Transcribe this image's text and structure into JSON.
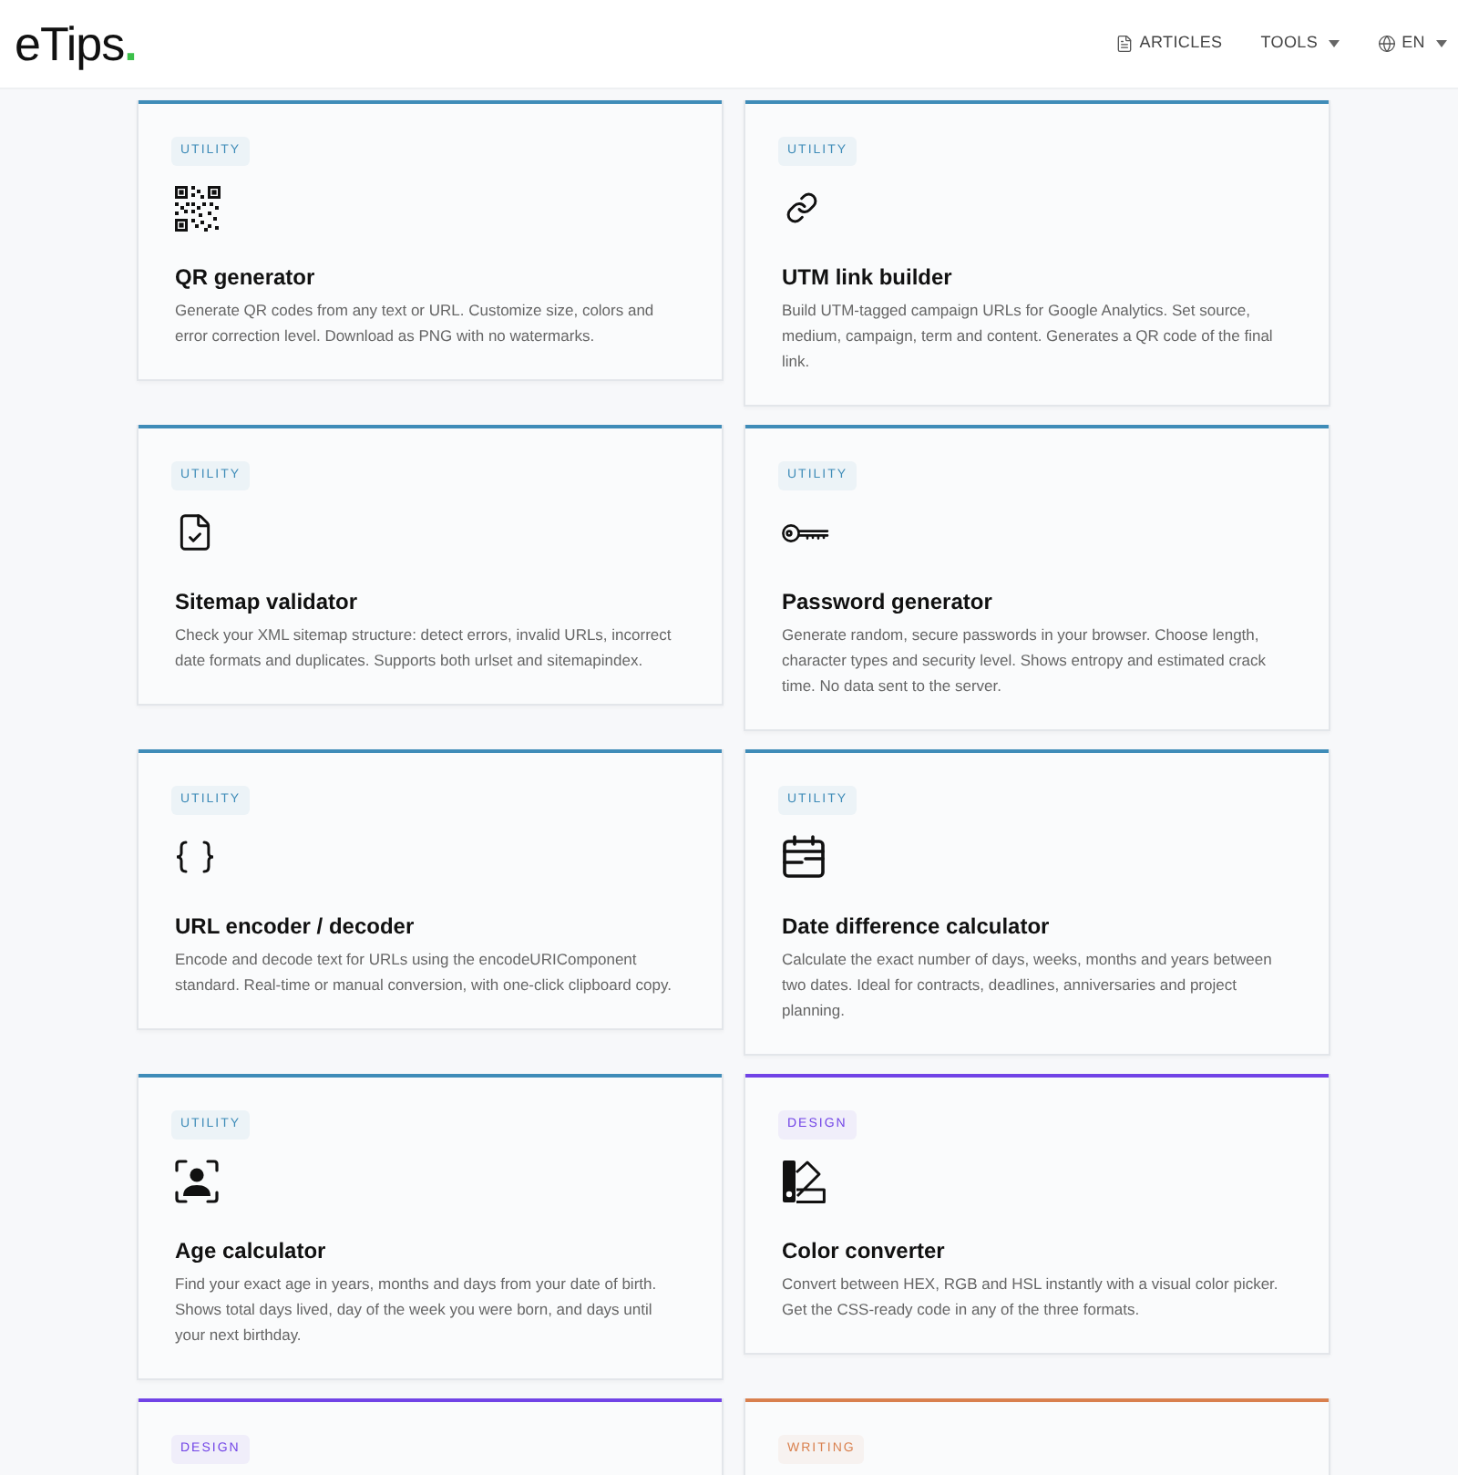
{
  "header": {
    "logo": {
      "text": "eTips",
      "dot": "."
    },
    "nav": [
      {
        "label": "ARTICLES",
        "kind": "link"
      },
      {
        "label": "TOOLS",
        "kind": "dropdown"
      },
      {
        "label": "EN",
        "kind": "language"
      }
    ]
  },
  "cards": [
    {
      "category": "UTILITY",
      "color": "#3f8cb8",
      "title": "QR generator",
      "description": "Generate QR codes from any text or URL. Customize size, colors and error correction level. Download as PNG with no watermarks."
    },
    {
      "category": "UTILITY",
      "color": "#3f8cb8",
      "title": "UTM link builder",
      "description": "Build UTM-tagged campaign URLs for Google Analytics. Set source, medium, campaign, term and content. Generates a QR code of the final link."
    },
    {
      "category": "UTILITY",
      "color": "#3f8cb8",
      "title": "Sitemap validator",
      "description": "Check your XML sitemap structure: detect errors, invalid URLs, incorrect date formats and duplicates. Supports both urlset and sitemapindex."
    },
    {
      "category": "UTILITY",
      "color": "#3f8cb8",
      "title": "Password generator",
      "description": "Generate random, secure passwords in your browser. Choose length, character types and security level. Shows entropy and estimated crack time. No data sent to the server."
    },
    {
      "category": "UTILITY",
      "color": "#3f8cb8",
      "title": "URL encoder / decoder",
      "description": "Encode and decode text for URLs using the encodeURIComponent standard. Real-time or manual conversion, with one-click clipboard copy."
    },
    {
      "category": "UTILITY",
      "color": "#3f8cb8",
      "title": "Date difference calculator",
      "description": "Calculate the exact number of days, weeks, months and years between two dates. Ideal for contracts, deadlines, anniversaries and project planning."
    },
    {
      "category": "UTILITY",
      "color": "#3f8cb8",
      "title": "Age calculator",
      "description": "Find your exact age in years, months and days from your date of birth. Shows total days lived, day of the week you were born, and days until your next birthday."
    },
    {
      "category": "DESIGN",
      "color": "#7143e6",
      "title": "Color converter",
      "description": "Convert between HEX, RGB and HSL instantly with a visual color picker. Get the CSS-ready code in any of the three formats."
    },
    {
      "category": "DESIGN",
      "color": "#7143e6"
    },
    {
      "category": "WRITING",
      "color": "#d9804e"
    }
  ]
}
